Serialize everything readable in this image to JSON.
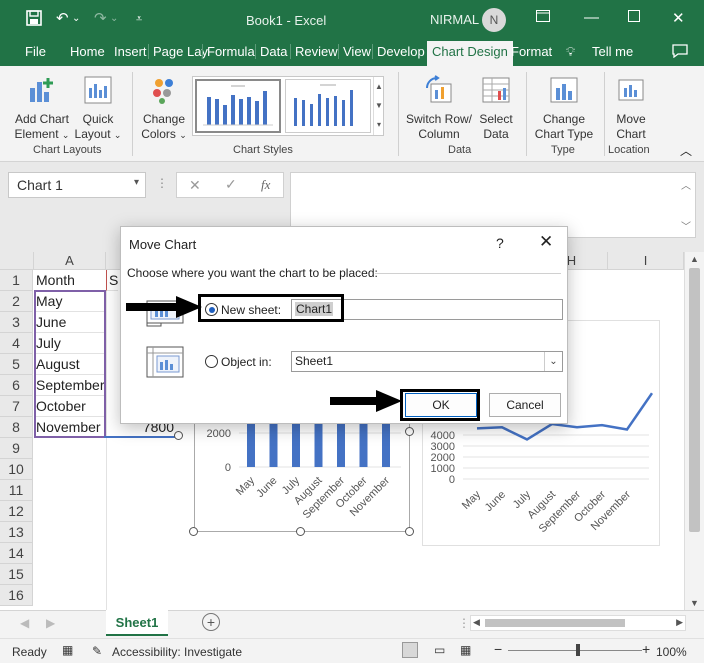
{
  "title_bar": {
    "document": "Book1  -  Excel",
    "user_name": "NIRMAL",
    "user_initial": "N"
  },
  "ribbon_tabs": [
    "File",
    "Home",
    "Insert",
    "Page Lay",
    "Formula",
    "Data",
    "Review",
    "View",
    "Develop",
    "Chart Design",
    "Format",
    "Tell me"
  ],
  "active_tab": "Chart Design",
  "ribbon": {
    "add_chart_element": [
      "Add Chart",
      "Element"
    ],
    "quick_layout": [
      "Quick",
      "Layout"
    ],
    "chart_layouts_label": "Chart Layouts",
    "change_colors": [
      "Change",
      "Colors"
    ],
    "chart_styles_label": "Chart Styles",
    "switch_row_column": [
      "Switch Row/",
      "Column"
    ],
    "select_data": [
      "Select",
      "Data"
    ],
    "data_label": "Data",
    "change_chart_type": [
      "Change",
      "Chart Type"
    ],
    "type_label": "Type",
    "move_chart": [
      "Move",
      "Chart"
    ],
    "location_label": "Location"
  },
  "formula_bar": {
    "name_box": "Chart 1",
    "fx": "fx"
  },
  "columns": [
    "A",
    "H",
    "I"
  ],
  "rows": [
    "1",
    "2",
    "3",
    "4",
    "5",
    "6",
    "7",
    "8",
    "9",
    "10",
    "11",
    "12",
    "13",
    "14",
    "15",
    "16"
  ],
  "cells": {
    "A1": "Month",
    "B1_partial": "Sa",
    "A2": "May",
    "A3": "June",
    "A4": "July",
    "A5": "August",
    "A6": "September",
    "A7": "October",
    "A8": "November",
    "B8_partial": "7800"
  },
  "chart_data": [
    {
      "type": "bar",
      "categories": [
        "May",
        "June",
        "July",
        "August",
        "September",
        "October",
        "November"
      ],
      "values": [
        4600,
        4700,
        3600,
        5000,
        4700,
        4900,
        4500
      ],
      "y_ticks": [
        "0",
        "2000",
        "4000"
      ]
    },
    {
      "type": "line",
      "categories": [
        "May",
        "June",
        "July",
        "August",
        "September",
        "October",
        "November"
      ],
      "values": [
        4600,
        4700,
        3600,
        5000,
        4700,
        4900,
        4500,
        7800
      ],
      "y_ticks": [
        "0",
        "1000",
        "2000",
        "3000",
        "4000"
      ]
    }
  ],
  "dialog": {
    "title": "Move Chart",
    "help": "?",
    "prompt": "Choose where you want the chart to be placed:",
    "new_sheet_label": "New sheet:",
    "new_sheet_value": "Chart1",
    "object_in_label": "Object in:",
    "object_in_value": "Sheet1",
    "ok": "OK",
    "cancel": "Cancel"
  },
  "sheet_tabs": [
    "Sheet1"
  ],
  "status": {
    "ready": "Ready",
    "accessibility": "Accessibility: Investigate",
    "zoom": "100%"
  },
  "colors": {
    "excel_green": "#217346",
    "series_blue": "#4472c4"
  }
}
